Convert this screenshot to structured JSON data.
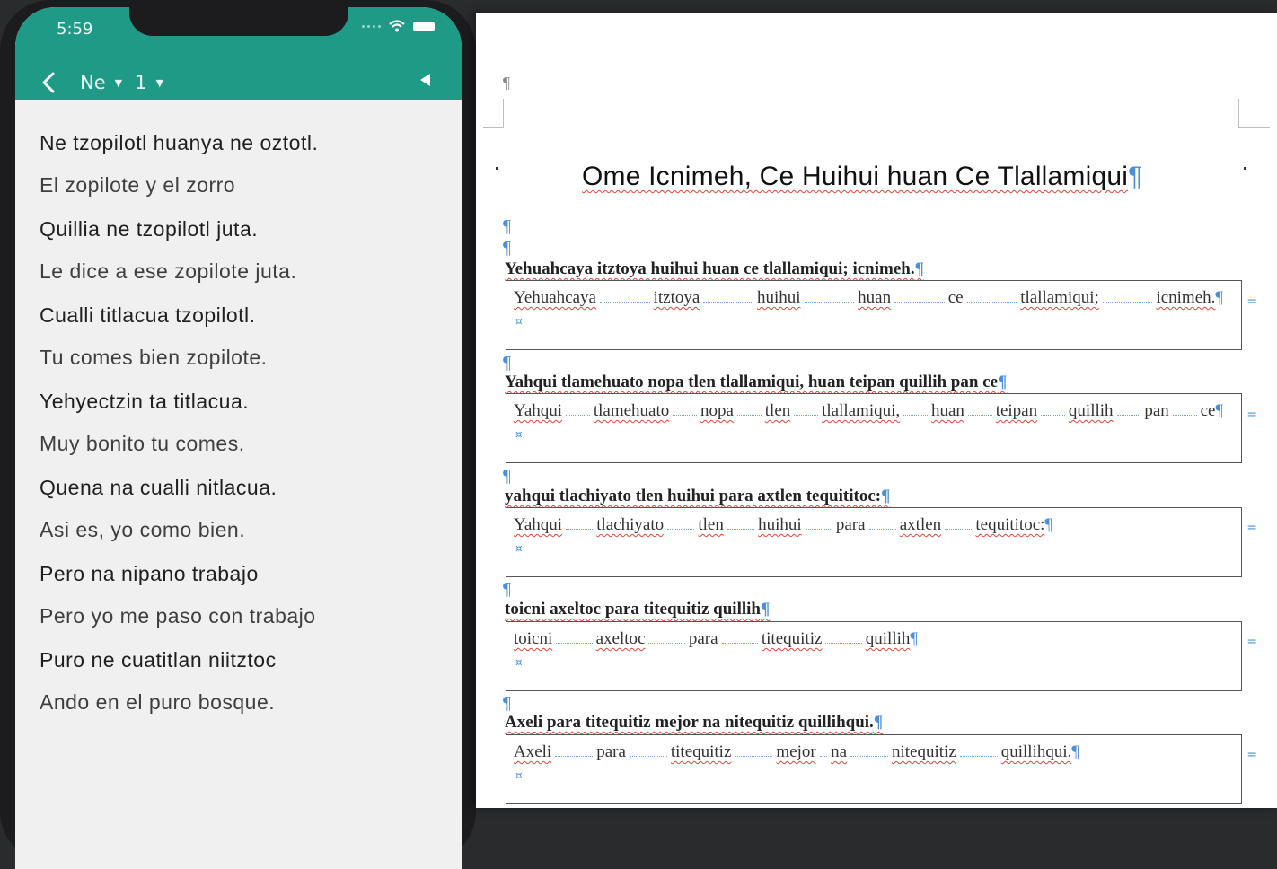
{
  "phone": {
    "time": "5:59",
    "toolbar": {
      "book": "Ne",
      "chapter": "1"
    },
    "lines": [
      {
        "nahuatl": "Ne tzopilotl huanya ne oztotl.",
        "spanish": "El zopilote y el zorro"
      },
      {
        "nahuatl": "Quillia ne tzopilotl juta.",
        "spanish": "Le dice a ese zopilote juta."
      },
      {
        "nahuatl": "Cualli titlacua tzopilotl.",
        "spanish": "Tu comes bien zopilote."
      },
      {
        "nahuatl": "Yehyectzin ta titlacua.",
        "spanish": "Muy bonito tu comes."
      },
      {
        "nahuatl": "Quena na cualli nitlacua.",
        "spanish": "Asi es, yo como bien."
      },
      {
        "nahuatl": "Pero na nipano trabajo",
        "spanish": "Pero yo me paso con trabajo"
      },
      {
        "nahuatl": "Puro ne cuatitlan niitztoc",
        "spanish": "Ando en el puro bosque."
      }
    ],
    "colors": {
      "accent": "#1e9a86"
    }
  },
  "document": {
    "title": "Ome Icnimeh, Ce Huihui huan Ce Tlallamiqui",
    "pilcrow": "¶",
    "paragraphs": [
      {
        "text": "Yehuahcaya itztoya huihui huan ce tlallamiqui; icnimeh.",
        "words": [
          "Yehuahcaya",
          "itztoya",
          "huihui",
          "huan",
          "ce",
          "tlallamiqui;",
          "icnimeh."
        ]
      },
      {
        "text": "Yahqui tlamehuato nopa tlen tlallamiqui, huan teipan quillih pan ce",
        "words": [
          "Yahqui",
          "tlamehuato",
          "nopa",
          "tlen",
          "tlallamiqui,",
          "huan",
          "teipan",
          "quillih",
          "pan",
          "ce"
        ]
      },
      {
        "text": "yahqui tlachiyato tlen huihui para axtlen tequititoc:",
        "words": [
          "Yahqui",
          "tlachiyato",
          "tlen",
          "huihui",
          "para",
          "axtlen",
          "tequititoc:"
        ]
      },
      {
        "text": "toicni axeltoc para titequitiz quillih",
        "words": [
          "toicni",
          "axeltoc",
          "para",
          "titequitiz",
          "quillih"
        ]
      },
      {
        "text": "Axeli para titequitiz mejor na nitequitiz quillihqui.",
        "words": [
          "Axeli",
          "para",
          "titequitiz",
          "mejor",
          "na",
          "nitequitiz",
          "quillihqui."
        ]
      }
    ]
  }
}
